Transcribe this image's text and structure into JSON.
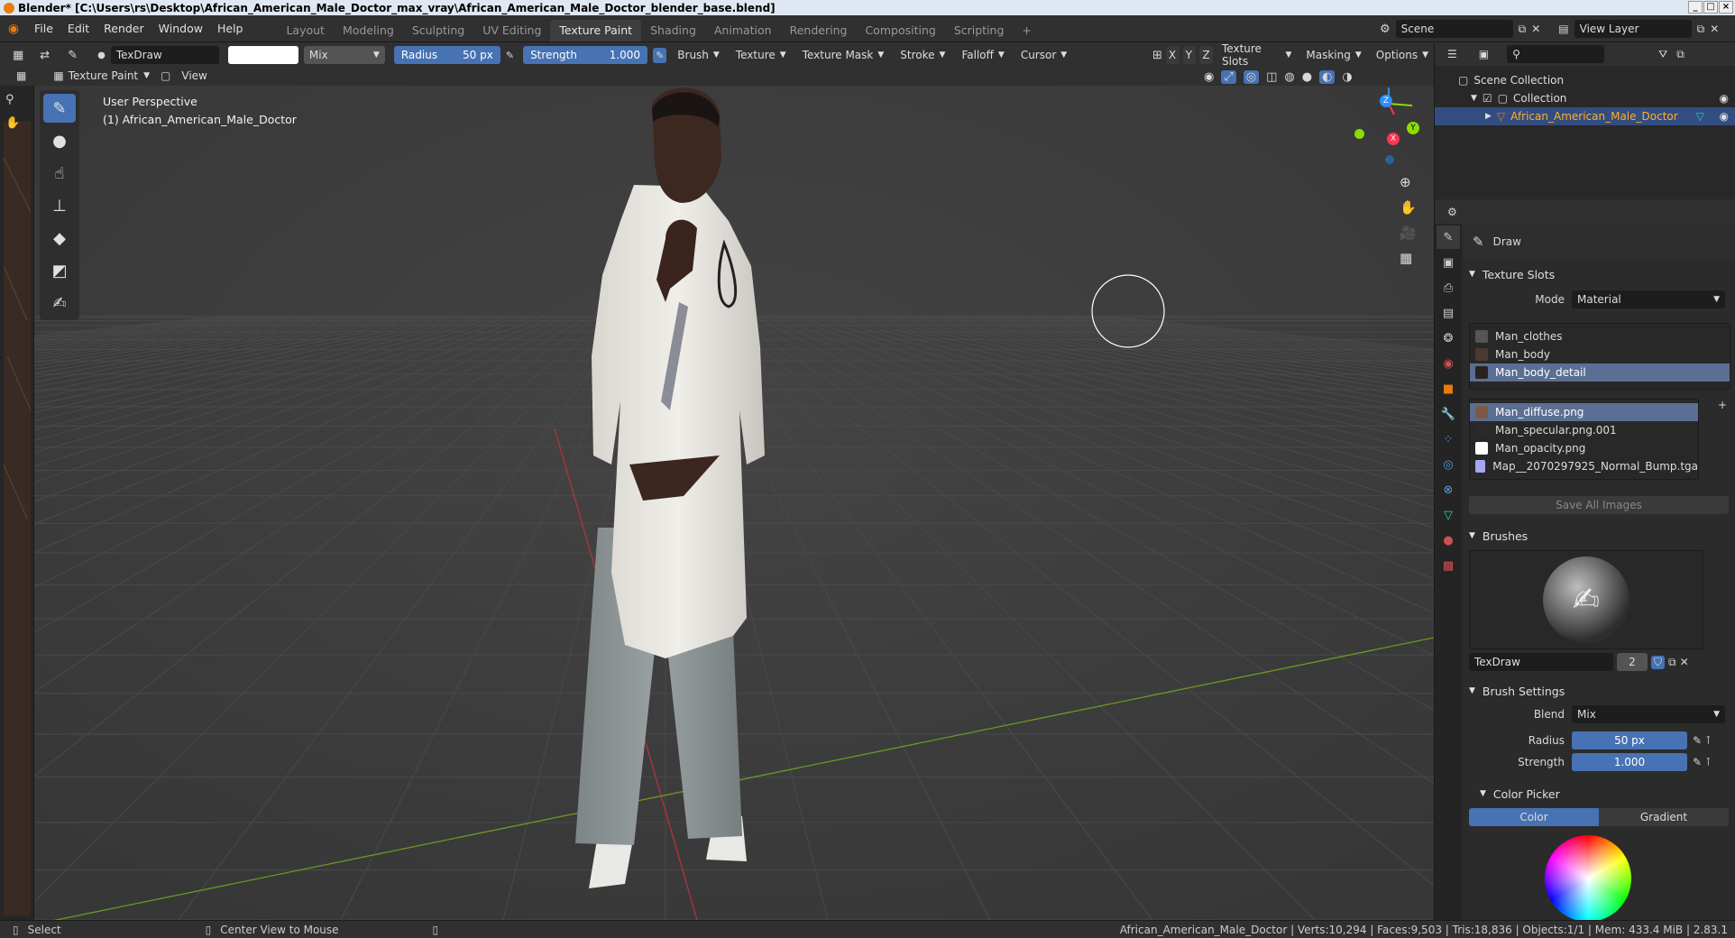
{
  "titlebar": {
    "text": "Blender* [C:\\Users\\rs\\Desktop\\African_American_Male_Doctor_max_vray\\African_American_Male_Doctor_blender_base.blend]"
  },
  "menu": [
    "File",
    "Edit",
    "Render",
    "Window",
    "Help"
  ],
  "workspaces": [
    "Layout",
    "Modeling",
    "Sculpting",
    "UV Editing",
    "Texture Paint",
    "Shading",
    "Animation",
    "Rendering",
    "Compositing",
    "Scripting"
  ],
  "workspace_add": "+",
  "scene": {
    "label": "Scene",
    "view_layer": "View Layer"
  },
  "header": {
    "brush_name": "TexDraw",
    "blend": "Mix",
    "radius_label": "Radius",
    "radius_value": "50 px",
    "strength_label": "Strength",
    "strength_value": "1.000",
    "menus": [
      "Brush",
      "Texture",
      "Texture Mask",
      "Stroke",
      "Falloff",
      "Cursor"
    ],
    "axes": [
      "X",
      "Y",
      "Z"
    ],
    "right_menus": [
      "Texture Slots",
      "Masking",
      "Options"
    ],
    "mode": "Texture Paint",
    "view": "View"
  },
  "viewport": {
    "perspective": "User Perspective",
    "object": "(1) African_American_Male_Doctor",
    "gizmo": {
      "z": "Z",
      "y": "Y",
      "x": "X"
    }
  },
  "outliner": {
    "scene_collection": "Scene Collection",
    "collection": "Collection",
    "object": "African_American_Male_Doctor"
  },
  "properties": {
    "tool_name": "Draw",
    "texture_slots": {
      "title": "Texture Slots",
      "mode_label": "Mode",
      "mode_value": "Material",
      "materials": [
        "Man_clothes",
        "Man_body",
        "Man_body_detail"
      ],
      "selected_material": 2,
      "images": [
        "Man_diffuse.png",
        "Man_specular.png.001",
        "Man_opacity.png",
        "Map__2070297925_Normal_Bump.tga"
      ],
      "image_colors": [
        "#7a5a44",
        "#2a2a2a",
        "#ffffff",
        "#a7a8f2"
      ],
      "selected_image": 0,
      "save_all": "Save All Images"
    },
    "brushes": {
      "title": "Brushes",
      "brush_name": "TexDraw",
      "users": "2"
    },
    "brush_settings": {
      "title": "Brush Settings",
      "blend_label": "Blend",
      "blend_value": "Mix",
      "radius_label": "Radius",
      "radius_value": "50 px",
      "strength_label": "Strength",
      "strength_value": "1.000"
    },
    "color_picker": {
      "title": "Color Picker",
      "tabs": [
        "Color",
        "Gradient"
      ]
    }
  },
  "statusbar": {
    "select": "Select",
    "center_view": "Center View to Mouse",
    "stats": "African_American_Male_Doctor | Verts:10,294 | Faces:9,503 | Tris:18,836 | Objects:1/1 | Mem: 433.4 MiB | 2.83.1"
  },
  "colors": {
    "accent": "#4772b3",
    "selection": "#5a6f93",
    "x_axis": "#ff3352",
    "y_axis": "#8bdc00",
    "z_axis": "#2890ff"
  }
}
